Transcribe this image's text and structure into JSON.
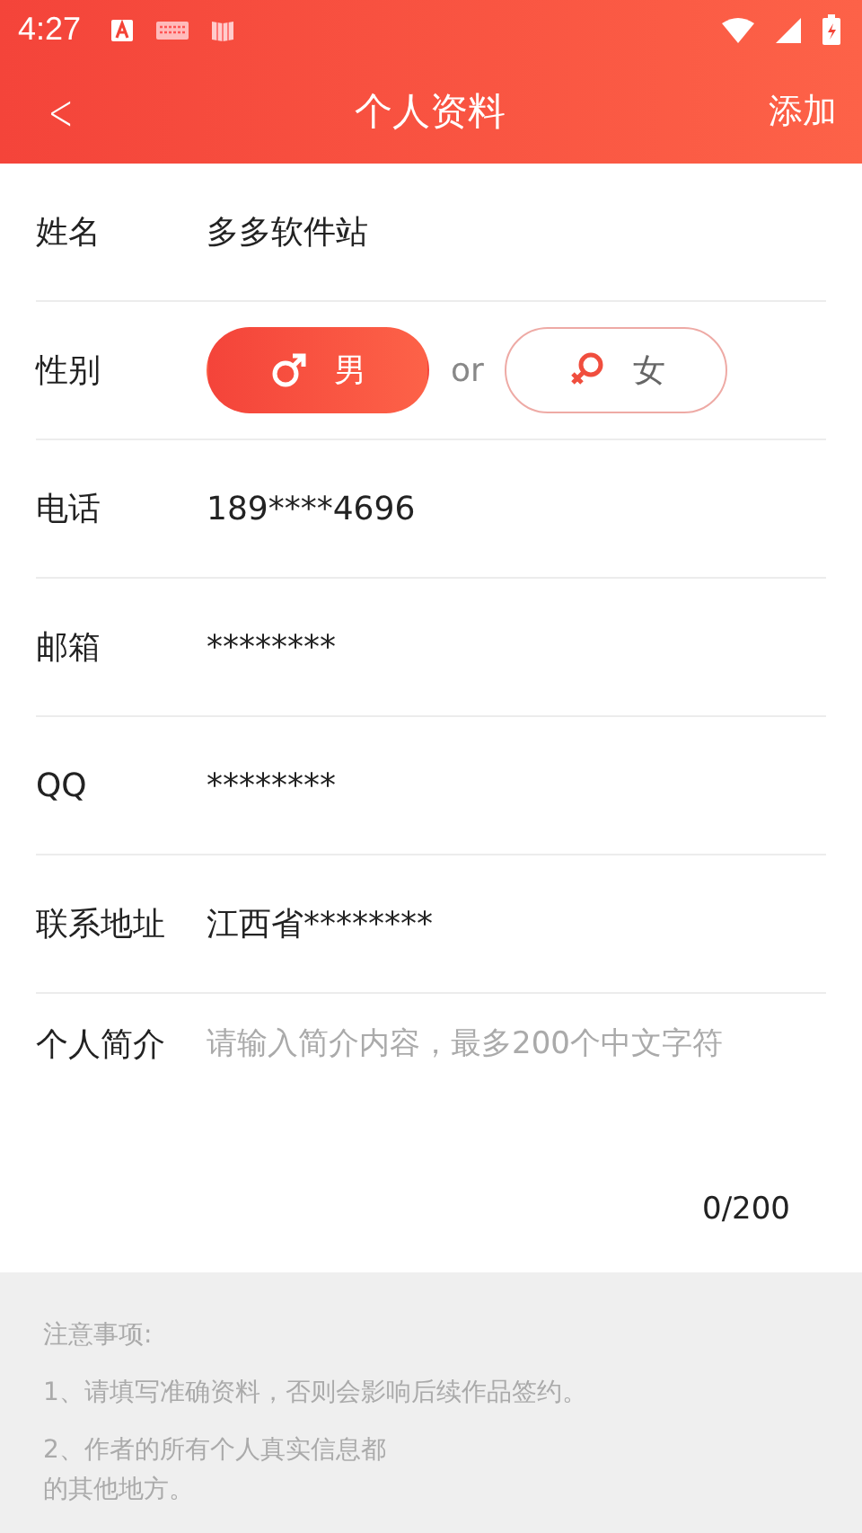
{
  "status_bar": {
    "time": "4:27"
  },
  "nav": {
    "back": "<",
    "title": "个人资料",
    "action": "添加"
  },
  "fields": [
    {
      "kind": "text",
      "label": "姓名",
      "value": "多多软件站"
    },
    {
      "kind": "gender",
      "label": "性别",
      "separator": "or",
      "options": [
        {
          "label": "男",
          "kind": "male",
          "selected": true
        },
        {
          "label": "女",
          "kind": "female",
          "selected": false
        }
      ]
    },
    {
      "kind": "text",
      "label": "电话",
      "value": "189****4696"
    },
    {
      "kind": "text",
      "label": "邮箱",
      "value": "********"
    },
    {
      "kind": "text",
      "label": "QQ",
      "value": "********"
    },
    {
      "kind": "text",
      "label": "联系地址",
      "value": "江西省********"
    },
    {
      "kind": "textarea",
      "label": "个人简介",
      "placeholder": "请输入简介内容，最多200个中文字符",
      "counter": "0/200"
    }
  ],
  "notes": {
    "title": "注意事项:",
    "items": [
      {
        "lines": [
          "1、请填写准确资料，否则会影响后续作品签约。"
        ]
      },
      {
        "lines": [
          "2、作者的所有个人真实信息都",
          "的其他地方。"
        ]
      }
    ]
  }
}
